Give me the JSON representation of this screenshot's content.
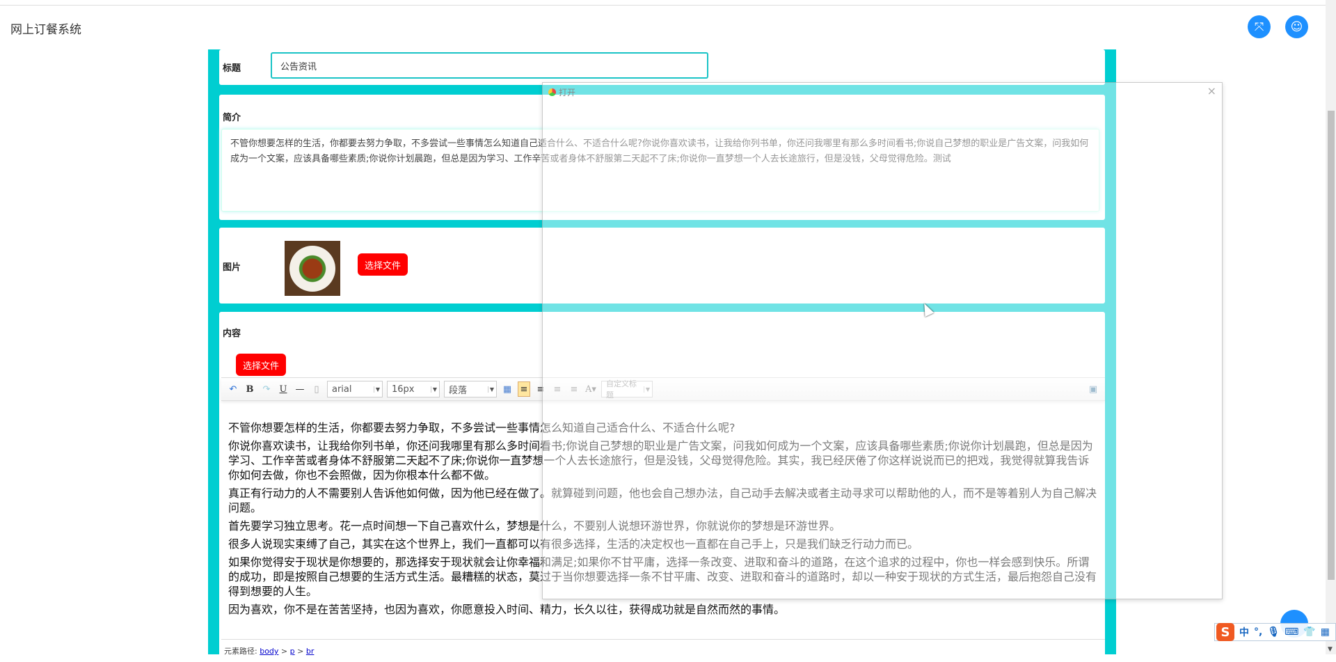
{
  "header": {
    "app_title": "网上订餐系统",
    "fullscreen_icon": "fullscreen-icon",
    "user_icon": "user-icon"
  },
  "form": {
    "title_label": "标题",
    "title_value": "公告资讯",
    "summary_label": "简介",
    "summary_value": "不管你想要怎样的生活，你都要去努力争取，不多尝试一些事情怎么知道自己适合什么、不适合什么呢?你说你喜欢读书，让我给你列书单，你还问我哪里有那么多时间看书;你说自己梦想的职业是广告文案，问我如何成为一个文案，应该具备哪些素质;你说你计划晨跑，但总是因为学习、工作辛苦或者身体不舒服第二天起不了床;你说你一直梦想一个人去长途旅行，但是没钱，父母觉得危险。测试",
    "image_label": "图片",
    "image_button": "选择文件",
    "content_label": "内容",
    "content_button": "选择文件"
  },
  "editor": {
    "toolbar": {
      "font": "arial",
      "size": "16px",
      "block": "段落",
      "custom_title": "自定义标题",
      "bold": "B",
      "underline": "U",
      "font_color": "A"
    },
    "paragraphs": [
      "不管你想要怎样的生活，你都要去努力争取，不多尝试一些事情怎么知道自己适合什么、不适合什么呢?",
      "你说你喜欢读书，让我给你列书单，你还问我哪里有那么多时间看书;你说自己梦想的职业是广告文案，问我如何成为一个文案，应该具备哪些素质;你说你计划晨跑，但总是因为学习、工作辛苦或者身体不舒服第二天起不了床;你说你一直梦想一个人去长途旅行，但是没钱，父母觉得危险。其实，我已经厌倦了你这样说说而已的把戏，我觉得就算我告诉你如何去做，你也不会照做，因为你根本什么都不做。",
      "真正有行动力的人不需要别人告诉他如何做，因为他已经在做了。就算碰到问题，他也会自己想办法，自己动手去解决或者主动寻求可以帮助他的人，而不是等着别人为自己解决问题。",
      "首先要学习独立思考。花一点时间想一下自己喜欢什么，梦想是什么，不要别人说想环游世界，你就说你的梦想是环游世界。",
      "很多人说现实束缚了自己，其实在这个世界上，我们一直都可以有很多选择，生活的决定权也一直都在自己手上，只是我们缺乏行动力而已。",
      "如果你觉得安于现状是你想要的，那选择安于现状就会让你幸福和满足;如果你不甘平庸，选择一条改变、进取和奋斗的道路，在这个追求的过程中，你也一样会感到快乐。所谓的成功，即是按照自己想要的生活方式生活。最糟糕的状态，莫过于当你想要选择一条不甘平庸、改变、进取和奋斗的道路时，却以一种安于现状的方式生活，最后抱怨自己没有得到想要的人生。",
      "因为喜欢，你不是在苦苦坚持，也因为喜欢，你愿意投入时间、精力，长久以往，获得成功就是自然而然的事情。"
    ],
    "path_label": "元素路径:",
    "path": [
      "body",
      "p",
      "br"
    ]
  },
  "dialog": {
    "title": "打开",
    "close": "×"
  },
  "ime": {
    "mode": "中",
    "punct": "°,"
  }
}
